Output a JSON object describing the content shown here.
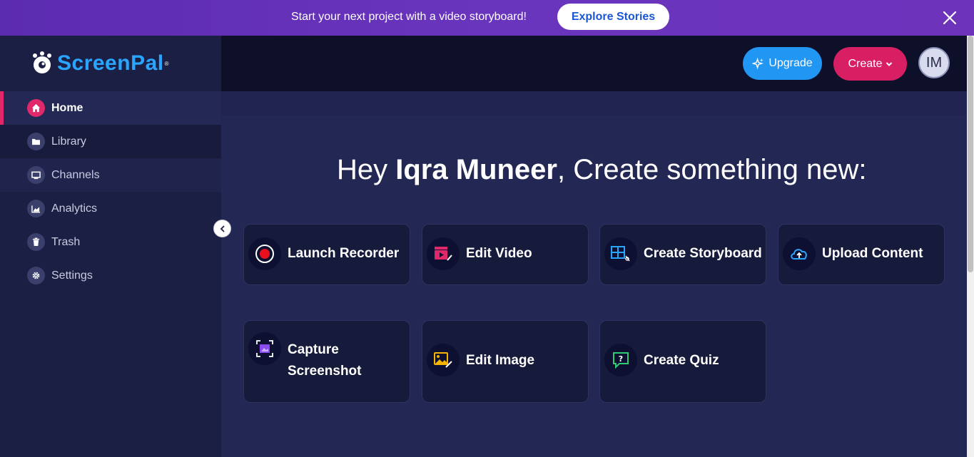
{
  "banner": {
    "text": "Start your next project with a video storyboard!",
    "cta_label": "Explore Stories"
  },
  "brand": {
    "name": "ScreenPal",
    "accent": "#2aa5ff"
  },
  "sidebar": {
    "items": [
      {
        "label": "Home",
        "icon": "home-icon",
        "active": true
      },
      {
        "label": "Library",
        "icon": "folder-icon"
      },
      {
        "label": "Channels",
        "icon": "monitor-icon"
      },
      {
        "label": "Analytics",
        "icon": "chart-icon"
      },
      {
        "label": "Trash",
        "icon": "trash-icon"
      },
      {
        "label": "Settings",
        "icon": "gear-icon"
      }
    ]
  },
  "topbar": {
    "upgrade_label": "Upgrade",
    "create_label": "Create",
    "avatar_initials": "IM"
  },
  "main": {
    "greeting_prefix": "Hey ",
    "user_name": "Iqra Muneer",
    "greeting_suffix": ", Create something new:",
    "cards": [
      {
        "label": "Launch Recorder",
        "icon": "record-icon"
      },
      {
        "label": "Edit Video",
        "icon": "video-edit-icon"
      },
      {
        "label": "Create Storyboard",
        "icon": "storyboard-icon"
      },
      {
        "label": "Upload Content",
        "icon": "cloud-upload-icon"
      },
      {
        "label": "Capture Screenshot",
        "line1": "Capture",
        "line2": "Screenshot",
        "icon": "screenshot-icon"
      },
      {
        "label": "Edit Image",
        "icon": "image-edit-icon"
      },
      {
        "label": "Create Quiz",
        "icon": "quiz-icon"
      }
    ]
  },
  "colors": {
    "banner": "#6a35bd",
    "sidebar_bg": "#1c1f44",
    "topbar_bg": "#0e1029",
    "main_bg": "#232753",
    "active_accent": "#e0286b",
    "upgrade": "#2196f3",
    "create": "#d81f63"
  }
}
